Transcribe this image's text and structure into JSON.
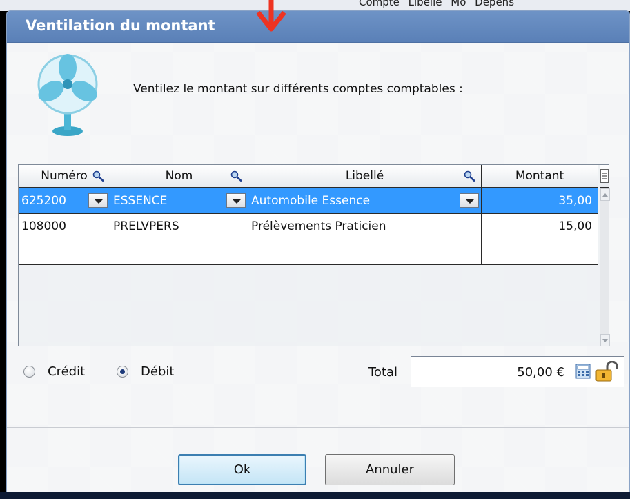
{
  "background": {
    "text": "Compte Libellé Mo Dépens"
  },
  "dialog": {
    "title": "Ventilation du montant",
    "instruction": "Ventilez le montant sur différents comptes comptables :"
  },
  "grid": {
    "columns": [
      "Numéro",
      "Nom",
      "Libellé",
      "Montant"
    ],
    "rows": [
      {
        "numero": "625200",
        "nom": "ESSENCE",
        "libelle": "Automobile Essence",
        "montant": "35,00"
      },
      {
        "numero": "108000",
        "nom": "PRELVPERS",
        "libelle": "Prélèvements Praticien",
        "montant": "15,00"
      },
      {
        "numero": "",
        "nom": "",
        "libelle": "",
        "montant": ""
      }
    ]
  },
  "options": {
    "credit_label": "Crédit",
    "debit_label": "Débit",
    "selected": "Débit"
  },
  "total": {
    "label": "Total",
    "value": "50,00 €"
  },
  "buttons": {
    "ok": "Ok",
    "cancel": "Annuler"
  },
  "colors": {
    "titlebar": "#5a80b7",
    "selection": "#3399ff",
    "default_button_border": "#3c7fb1"
  },
  "icons": [
    "fan-icon",
    "search-icon",
    "column-chooser-icon",
    "calculator-icon",
    "lock-icon",
    "red-arrow-icon"
  ]
}
